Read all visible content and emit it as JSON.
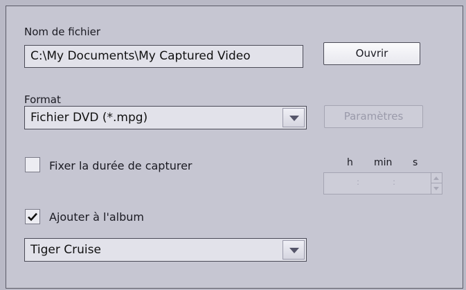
{
  "file": {
    "label": "Nom de fichier",
    "value": "C:\\My Documents\\My Captured Video",
    "open_button": "Ouvrir"
  },
  "format": {
    "label": "Format",
    "selected": "Fichier DVD (*.mpg)",
    "settings_button": "Paramètres",
    "settings_enabled": false
  },
  "duration": {
    "checkbox_label": "Fixer la durée de capturer",
    "checked": false,
    "units": {
      "h": "h",
      "min": "min",
      "s": "s"
    },
    "separator": ":",
    "enabled": false
  },
  "album": {
    "checkbox_label": "Ajouter à l'album",
    "checked": true,
    "selected": "Tiger Cruise"
  },
  "icons": {
    "dropdown": "chevron-down-icon",
    "checkmark": "checkmark-icon",
    "spin": "spin-arrows-icon"
  },
  "colors": {
    "panel": "#c6c6d2",
    "field": "#e2e2ea",
    "border": "#4a4a56",
    "disabled_text": "#9a9aaa"
  }
}
